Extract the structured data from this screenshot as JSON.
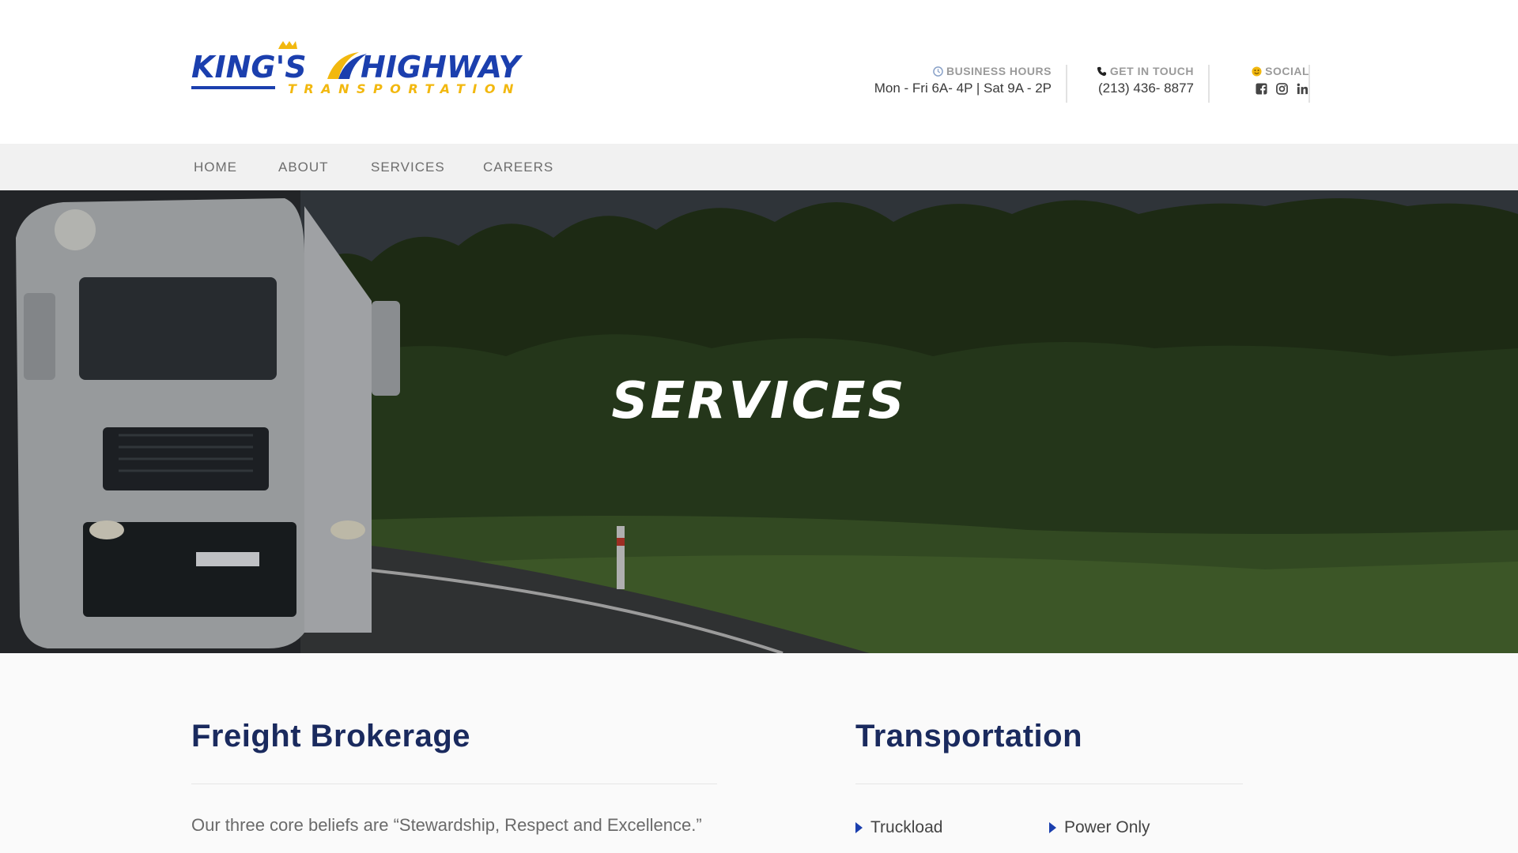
{
  "brand": {
    "logo_word1": "KING'S",
    "logo_word2": "HIGHWAY",
    "logo_sub": "TRANSPORTATION",
    "colors": {
      "blue": "#1b3fae",
      "yellow": "#f2b80f",
      "navy": "#1a2a5e"
    }
  },
  "header": {
    "hours_label": "BUSINESS HOURS",
    "hours_value": "Mon - Fri 6A- 4P | Sat 9A - 2P",
    "touch_label": "GET IN TOUCH",
    "touch_value": "(213) 436- 8877",
    "social_label": "SOCIAL",
    "icons": [
      "clock-icon",
      "phone-icon",
      "smile-icon",
      "facebook-icon",
      "instagram-icon",
      "linkedin-icon"
    ]
  },
  "nav": {
    "items": [
      "HOME",
      "ABOUT",
      "SERVICES",
      "CAREERS"
    ]
  },
  "hero": {
    "title": "SERVICES"
  },
  "main": {
    "freight": {
      "title": "Freight Brokerage",
      "text": "Our three core beliefs are “Stewardship, Respect and Excellence.”"
    },
    "transportation": {
      "title": "Transportation",
      "items": [
        "Truckload",
        "Power Only"
      ]
    }
  }
}
